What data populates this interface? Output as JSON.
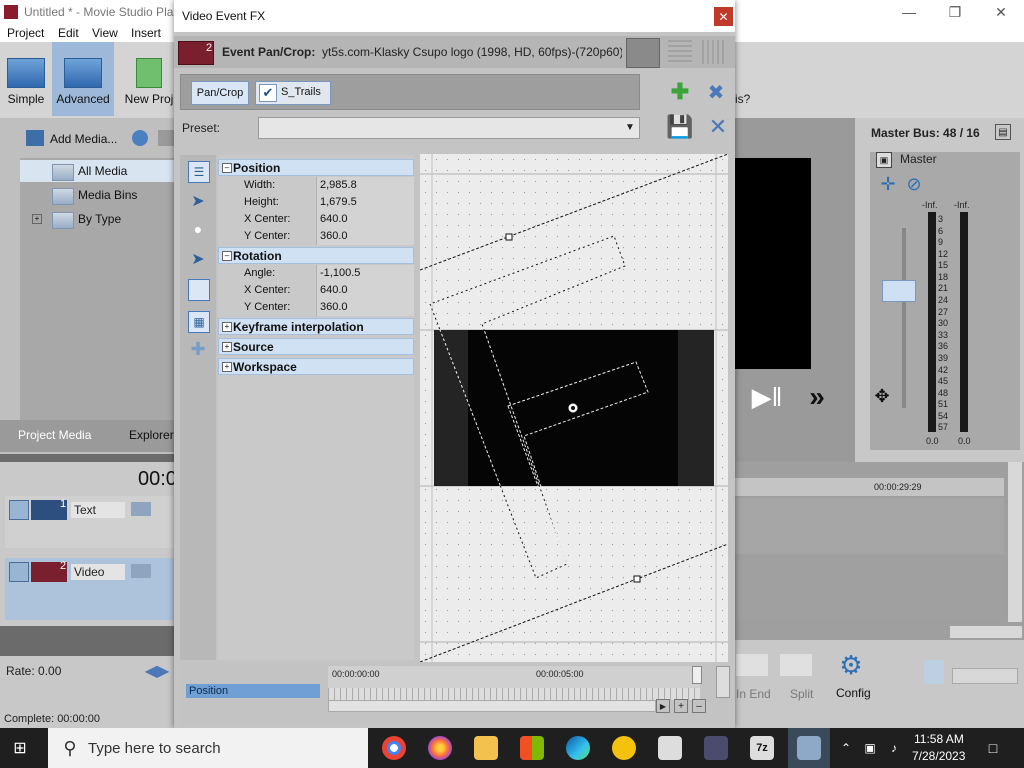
{
  "app": {
    "title": "Untitled * - Movie Studio Pla",
    "menus": [
      "Project",
      "Edit",
      "View",
      "Insert"
    ],
    "toolbar": {
      "simple": "Simple",
      "advanced": "Advanced",
      "new_project": "New Proj"
    },
    "help_fragment": "is?",
    "media": {
      "add_media": "Add Media...",
      "tree": [
        "All Media",
        "Media Bins",
        "By Type"
      ],
      "tabs": [
        "Project Media",
        "Explorer"
      ]
    },
    "timecode": "00:0",
    "tracks": [
      {
        "number": "1",
        "name": "Text"
      },
      {
        "number": "2",
        "name": "Video"
      }
    ],
    "rate": "Rate: 0.00",
    "complete": "Complete: 00:00:00",
    "master_bus": {
      "title": "Master Bus: 48 / 16",
      "label": "Master",
      "inf_left": "-Inf.",
      "inf_right": "-Inf.",
      "scale": [
        "3",
        "6",
        "9",
        "12",
        "15",
        "18",
        "21",
        "24",
        "27",
        "30",
        "33",
        "36",
        "39",
        "42",
        "45",
        "48",
        "51",
        "54",
        "57"
      ],
      "zero_left": "0.0",
      "zero_right": "0.0"
    },
    "right_timecode": "00:00:29:29",
    "bottom_tools": {
      "in_end": "In End",
      "split": "Split",
      "config": "Config"
    }
  },
  "dialog": {
    "title": "Video Event FX",
    "event_number": "2",
    "event_label": "Event Pan/Crop:",
    "event_file": "yt5s.com-Klasky Csupo logo (1998, HD, 60fps)-(720p60) (1",
    "chain": [
      "Pan/Crop",
      "S_Trails"
    ],
    "preset_label": "Preset:",
    "sections": {
      "position": {
        "title": "Position",
        "rows": [
          [
            "Width:",
            "2,985.8"
          ],
          [
            "Height:",
            "1,679.5"
          ],
          [
            "X Center:",
            "640.0"
          ],
          [
            "Y Center:",
            "360.0"
          ]
        ]
      },
      "rotation": {
        "title": "Rotation",
        "rows": [
          [
            "Angle:",
            "-1,100.5"
          ],
          [
            "X Center:",
            "640.0"
          ],
          [
            "Y Center:",
            "360.0"
          ]
        ]
      },
      "collapsed": [
        "Keyframe interpolation",
        "Source",
        "Workspace"
      ]
    },
    "timeline": {
      "t0": "00:00:00:00",
      "t1": "00:00:05:00",
      "track": "Position"
    }
  },
  "taskbar": {
    "search": "Type here to search",
    "time": "11:58 AM",
    "date": "7/28/2023"
  }
}
